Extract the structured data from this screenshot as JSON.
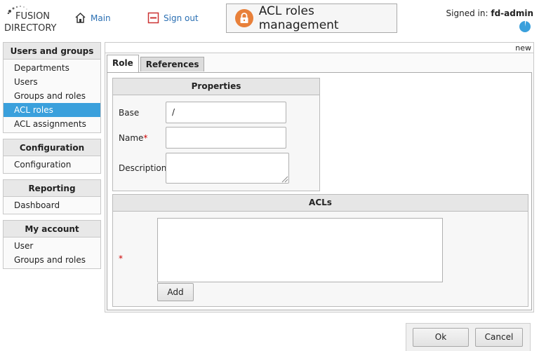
{
  "header": {
    "brand_top": "FUSION",
    "brand_bottom": "DIRECTORY",
    "main_link": "Main",
    "signout_link": "Sign out",
    "page_title": "ACL roles management",
    "signed_in_label": "Signed in:",
    "signed_in_user": "fd-admin"
  },
  "sidebar": {
    "sections": [
      {
        "title": "Users and groups",
        "items": [
          "Departments",
          "Users",
          "Groups and roles",
          "ACL roles",
          "ACL assignments"
        ],
        "active": "ACL roles"
      },
      {
        "title": "Configuration",
        "items": [
          "Configuration"
        ]
      },
      {
        "title": "Reporting",
        "items": [
          "Dashboard"
        ]
      },
      {
        "title": "My account",
        "items": [
          "User",
          "Groups and roles"
        ]
      }
    ]
  },
  "main": {
    "corner_label": "new",
    "tabs": [
      {
        "label": "Role",
        "active": true
      },
      {
        "label": "References",
        "active": false
      }
    ],
    "properties": {
      "title": "Properties",
      "base_label": "Base",
      "base_value": "/",
      "name_label": "Name",
      "name_required": "*",
      "name_value": "",
      "description_label": "Description",
      "description_value": ""
    },
    "acls": {
      "title": "ACLs",
      "required": "*",
      "add_button": "Add"
    }
  },
  "footer": {
    "ok_button": "Ok",
    "cancel_button": "Cancel"
  },
  "colors": {
    "accent": "#3aa0dc",
    "link": "#2a6fb3",
    "title_icon": "#e8803a",
    "required": "#cc0000"
  }
}
